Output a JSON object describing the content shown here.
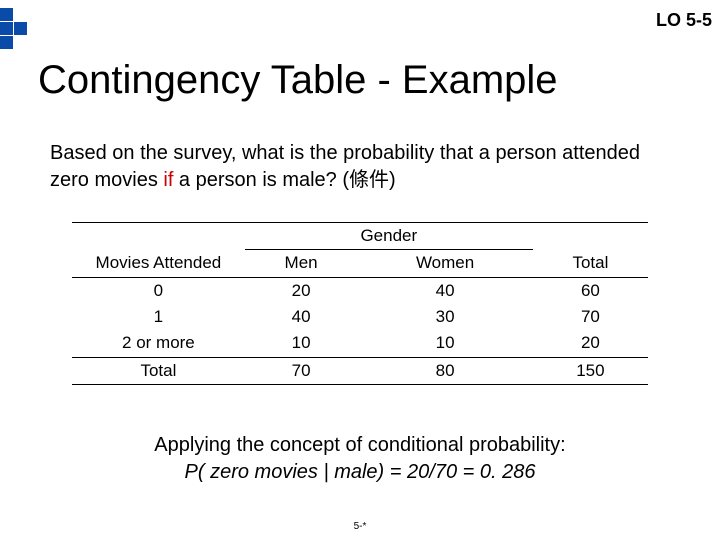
{
  "lo_label": "LO 5-5",
  "title": "Contingency Table - Example",
  "question_part1": "Based on the survey, what is the probability that a person attended zero movies ",
  "question_if": "if",
  "question_part2": " a person is male?  (條件)",
  "table": {
    "gender_header": "Gender",
    "col_movies": "Movies Attended",
    "col_men": "Men",
    "col_women": "Women",
    "col_total": "Total",
    "rows": [
      {
        "label": "0",
        "men": "20",
        "women": "40",
        "total": "60"
      },
      {
        "label": "1",
        "men": "40",
        "women": "30",
        "total": "70"
      },
      {
        "label": "2 or more",
        "men": "10",
        "women": "10",
        "total": "20"
      }
    ],
    "total_label": "Total",
    "totals": {
      "men": "70",
      "women": "80",
      "total": "150"
    }
  },
  "concept_line1": "Applying the concept of conditional probability:",
  "concept_line2": "P( zero movies | male) = 20/70 = 0. 286",
  "page_num": "5-*",
  "chart_data": {
    "type": "table",
    "title": "Contingency Table - Movies Attended by Gender",
    "row_variable": "Movies Attended",
    "col_variable": "Gender",
    "columns": [
      "Men",
      "Women",
      "Total"
    ],
    "rows": [
      {
        "category": "0",
        "Men": 20,
        "Women": 40,
        "Total": 60
      },
      {
        "category": "1",
        "Men": 40,
        "Women": 30,
        "Total": 70
      },
      {
        "category": "2 or more",
        "Men": 10,
        "Women": 10,
        "Total": 20
      },
      {
        "category": "Total",
        "Men": 70,
        "Women": 80,
        "Total": 150
      }
    ],
    "conditional_probability": {
      "event": "zero movies",
      "given": "male",
      "numerator": 20,
      "denominator": 70,
      "value": 0.286
    }
  }
}
